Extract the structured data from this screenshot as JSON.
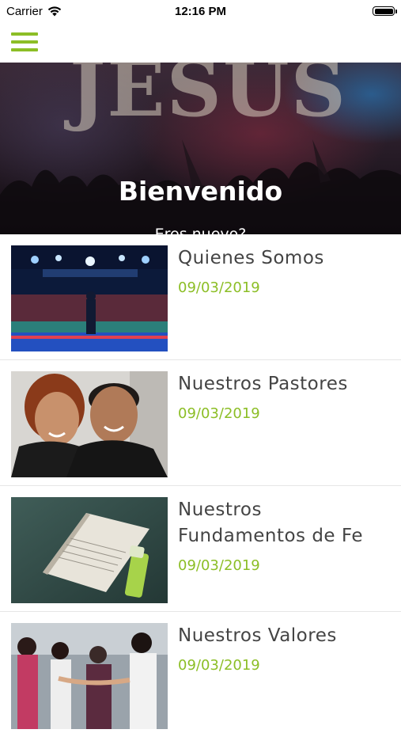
{
  "status_bar": {
    "carrier": "Carrier",
    "time": "12:16 PM"
  },
  "nav": {
    "menu_icon": "hamburger-menu-icon",
    "accent_color": "#8cbe26"
  },
  "hero": {
    "background_text": "JESUS",
    "title": "Bienvenido",
    "subtitle": "Eres nuevo?"
  },
  "items": [
    {
      "title": "Quienes Somos",
      "date": "09/03/2019",
      "image": "church-stage-photo"
    },
    {
      "title": "Nuestros Pastores",
      "date": "09/03/2019",
      "image": "pastors-couple-photo"
    },
    {
      "title": "Nuestros Fundamentos de Fe",
      "date": "09/03/2019",
      "image": "open-bible-photo"
    },
    {
      "title": "Nuestros Valores",
      "date": "09/03/2019",
      "image": "congregation-prayer-photo"
    }
  ]
}
